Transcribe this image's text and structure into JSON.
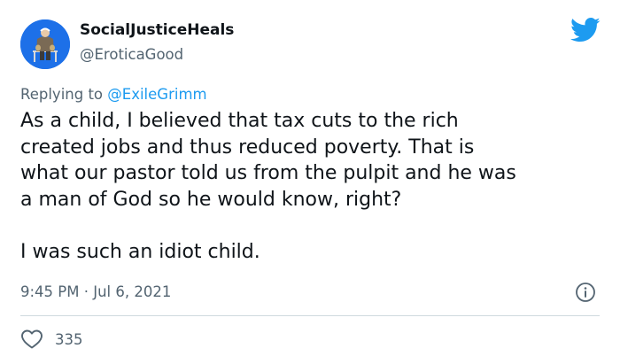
{
  "tweet": {
    "author": {
      "display_name": "SocialJusticeHeals",
      "handle": "@EroticaGood"
    },
    "reply_to": {
      "prefix": "Replying to",
      "handle": "@ExileGrimm"
    },
    "text_lines": [
      "As a child, I believed that tax cuts to the rich",
      "created jobs and thus reduced poverty. That is",
      "what our pastor told us from the pulpit and he was",
      "a man of God so he would know, right?",
      "I was such an idiot child."
    ],
    "timestamp": "9:45 PM · Jul 6, 2021",
    "like_count": "335"
  },
  "icons": {
    "brand": "twitter-bird-icon",
    "info": "info-icon",
    "like": "heart-icon"
  },
  "colors": {
    "brand_blue": "#1d9bf0",
    "secondary_text": "#536471",
    "primary_text": "#0f1419",
    "avatar_background": "#1d70e8"
  }
}
